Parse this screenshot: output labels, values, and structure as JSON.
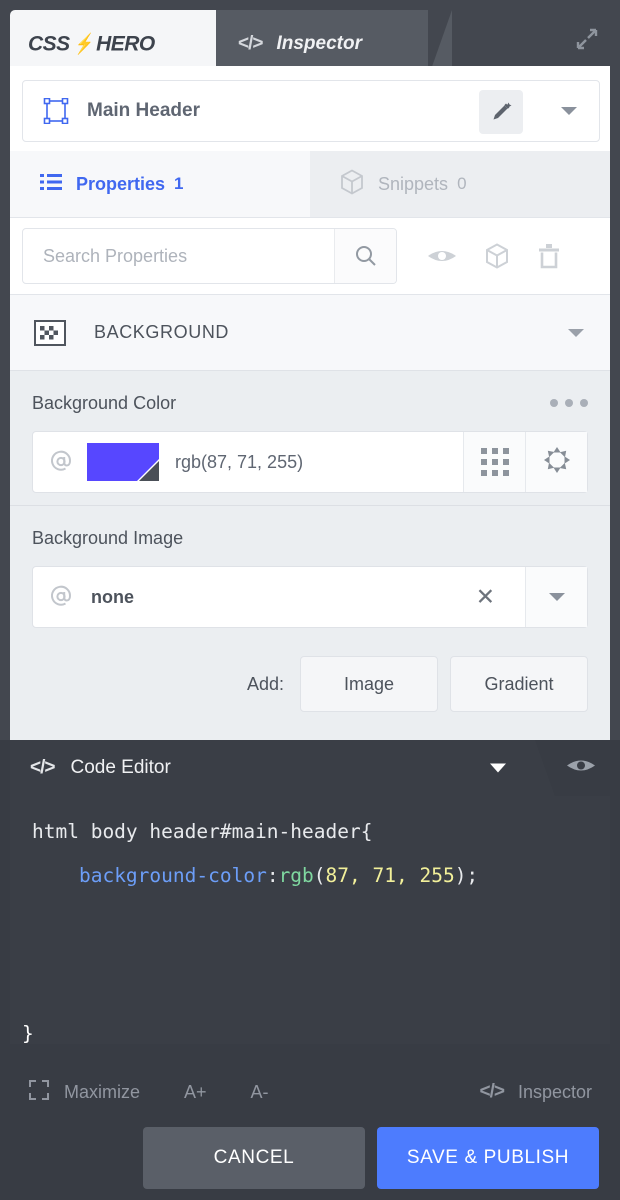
{
  "app": {
    "brand_primary": "CSS",
    "brand_bolt": "⚡",
    "brand_secondary": "HERO",
    "expand_icon": "expand-icon",
    "accent_color": "#4d7cfe",
    "tab_active_color": "#4068f0"
  },
  "topbar": {
    "inspector_tab": {
      "label": "Inspector",
      "icon": "code-icon",
      "icon_glyph": "</>"
    }
  },
  "selector": {
    "icon": "selection-box-icon",
    "name": "Main Header",
    "edit_icon": "pencil-edit-icon",
    "dropdown_icon": "chevron-down-icon"
  },
  "tabs": [
    {
      "label": "Properties",
      "count": "1",
      "icon": "list-icon",
      "active": true
    },
    {
      "label": "Snippets",
      "count": "0",
      "icon": "cube-icon",
      "active": false
    }
  ],
  "search": {
    "placeholder": "Search Properties",
    "value": "",
    "search_icon": "search-icon",
    "tools": [
      {
        "icon": "eye-icon",
        "name": "preview-toggle"
      },
      {
        "icon": "cube-icon",
        "name": "snippets-tool"
      },
      {
        "icon": "trash-icon",
        "name": "delete-tool"
      }
    ]
  },
  "section": {
    "icon": "checkerboard-icon",
    "title": "BACKGROUND",
    "collapse_icon": "chevron-down-icon"
  },
  "properties": [
    {
      "label": "Background Color",
      "menu_icon": "ellipsis-icon",
      "at_icon": "at-icon",
      "swatch_color": "#5747ff",
      "value": "rgb(87, 71, 255)",
      "buttons": [
        {
          "icon": "grid-dots-icon",
          "name": "color-palette-button"
        },
        {
          "icon": "color-wheel-icon",
          "name": "color-picker-button"
        }
      ]
    },
    {
      "label": "Background Image",
      "at_icon": "at-icon",
      "value": "none",
      "clear_icon": "close-x-icon",
      "dropdown_icon": "chevron-down-icon",
      "add_label": "Add:",
      "add_buttons": [
        "Image",
        "Gradient"
      ]
    }
  ],
  "code_editor": {
    "tab_label": "Code Editor",
    "tab_icon": "code-icon",
    "tab_icon_glyph": "</>",
    "collapse_icon": "chevron-down-icon",
    "eye_icon": "eye-icon",
    "code": {
      "selector": "html body header#main-header{",
      "indent": "    ",
      "property": "background-color",
      "colon": ":",
      "func": "rgb",
      "open_paren": "(",
      "args": "87, 71, 255",
      "close": ");",
      "closing_brace": "}"
    },
    "footer": {
      "maximize": {
        "label": "Maximize",
        "icon": "maximize-icon"
      },
      "font_increase": "A+",
      "font_decrease": "A-",
      "inspector": {
        "label": "Inspector",
        "icon": "code-icon",
        "icon_glyph": "</>"
      }
    }
  },
  "actions": {
    "cancel": "CANCEL",
    "save": "SAVE & PUBLISH"
  }
}
